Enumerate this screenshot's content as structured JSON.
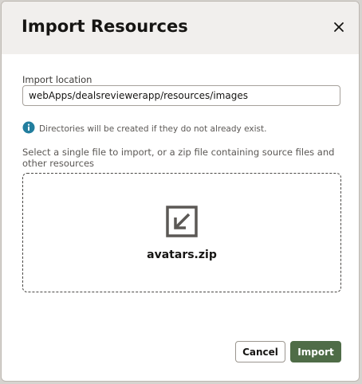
{
  "dialog": {
    "title": "Import Resources",
    "close_icon": "close-icon"
  },
  "location": {
    "label": "Import location",
    "value": "webApps/dealsreviewerapp/resources/images"
  },
  "info": {
    "icon": "info-icon",
    "text": "Directories will be created if they do not already exist.",
    "color": "#227e9e"
  },
  "dropzone": {
    "instructions": "Select a single file to import, or a zip file containing source files and other resources",
    "file_icon": "import-arrow-icon",
    "file_name": "avatars.zip"
  },
  "buttons": {
    "cancel_label": "Cancel",
    "import_label": "Import",
    "import_color": "#4f6c47"
  }
}
